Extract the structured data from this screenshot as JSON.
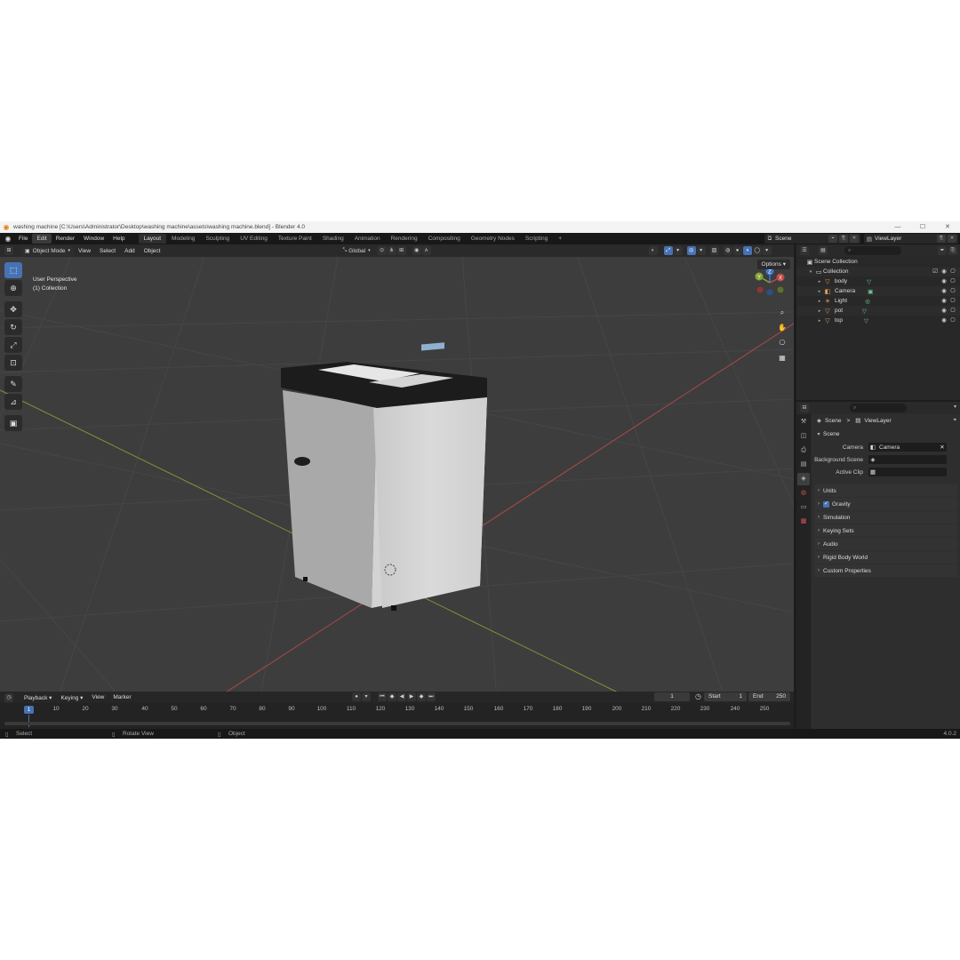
{
  "window": {
    "title": "washing machine [C:\\Users\\Administrator\\Desktop\\washing machine\\assets\\washing machine.blend] - Blender 4.0",
    "minimize": "—",
    "maximize": "☐",
    "close": "✕"
  },
  "menu": [
    "File",
    "Edit",
    "Render",
    "Window",
    "Help"
  ],
  "workspaces": [
    "Layout",
    "Modeling",
    "Sculpting",
    "UV Editing",
    "Texture Paint",
    "Shading",
    "Animation",
    "Rendering",
    "Compositing",
    "Geometry Nodes",
    "Scripting",
    "+"
  ],
  "active_workspace": "Layout",
  "scene_name": "Scene",
  "view_layer": "ViewLayer",
  "viewport": {
    "mode": "Object Mode",
    "menus": [
      "View",
      "Select",
      "Add",
      "Object"
    ],
    "transform_orientation": "Global",
    "perspective": "User Perspective",
    "collection_label": "(1) Collection",
    "options": "Options",
    "gizmo": {
      "x": "X",
      "y": "Y",
      "z": "Z"
    }
  },
  "timeline": {
    "menus": [
      "Playback",
      "Keying",
      "View",
      "Marker"
    ],
    "current_frame": "1",
    "start_label": "Start",
    "start": "1",
    "end_label": "End",
    "end": "250",
    "ruler": [
      "1",
      "10",
      "20",
      "30",
      "40",
      "50",
      "60",
      "70",
      "80",
      "90",
      "100",
      "110",
      "120",
      "130",
      "140",
      "150",
      "160",
      "170",
      "180",
      "190",
      "200",
      "210",
      "220",
      "230",
      "240",
      "250"
    ]
  },
  "status": {
    "select": "Select",
    "rotate": "Rotate View",
    "object": "Object",
    "version": "4.0.2"
  },
  "outliner": {
    "scene_collection": "Scene Collection",
    "collection": "Collection",
    "items": [
      {
        "name": "body",
        "icon": "mesh-icon"
      },
      {
        "name": "Camera",
        "icon": "camera-icon"
      },
      {
        "name": "Light",
        "icon": "light-icon"
      },
      {
        "name": "pot",
        "icon": "mesh-icon"
      },
      {
        "name": "top",
        "icon": "mesh-icon"
      }
    ]
  },
  "properties": {
    "breadcrumb_scene": "Scene",
    "breadcrumb_sep": ">",
    "breadcrumb_viewlayer": "ViewLayer",
    "scene_panel": "Scene",
    "camera_label": "Camera",
    "camera_value": "Camera",
    "background_label": "Background Scene",
    "active_clip_label": "Active Clip",
    "panels": [
      "Units",
      "Gravity",
      "Simulation",
      "Keying Sets",
      "Audio",
      "Rigid Body World",
      "Custom Properties"
    ]
  },
  "colors": {
    "accent": "#4772b3",
    "x_axis": "#c04a4a",
    "y_axis": "#87a33a",
    "z_axis": "#3c78d8"
  }
}
